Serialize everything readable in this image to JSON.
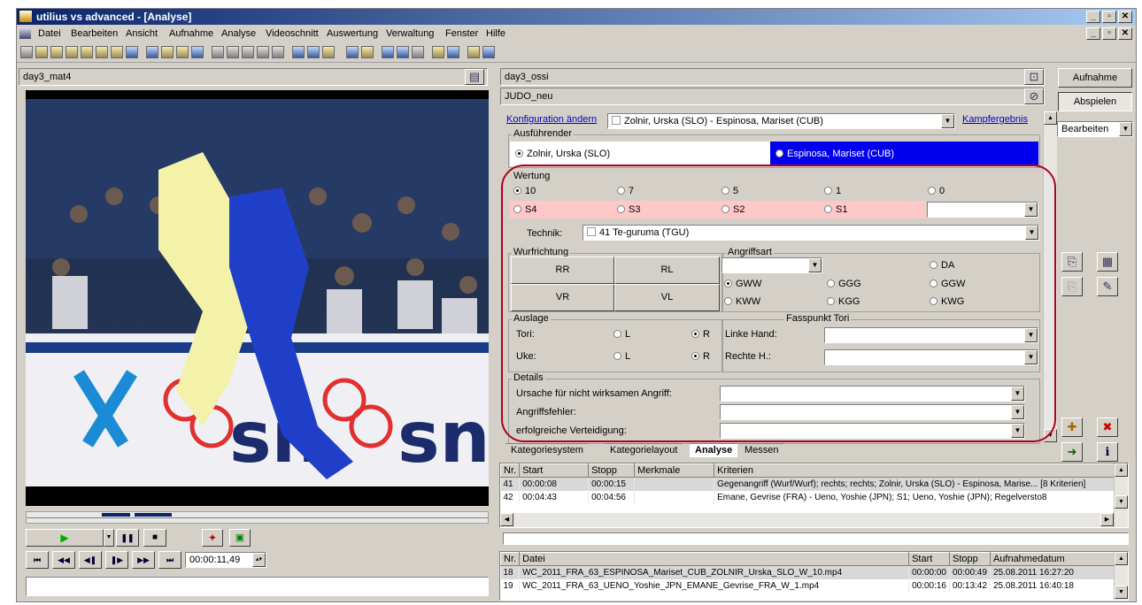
{
  "window": {
    "title": "utilius vs advanced - [Analyse]"
  },
  "menu": [
    "Datei",
    "Bearbeiten",
    "Ansicht",
    "Aufnahme",
    "Analyse",
    "Videoschnitt",
    "Auswertung",
    "Verwaltung",
    "Fenster",
    "Hilfe"
  ],
  "video_panel": {
    "title": "day3_mat4",
    "time": "00:00:11,49"
  },
  "right": {
    "field1": "day3_ossi",
    "field2": "JUDO_neu",
    "aufnahme_btn": "Aufnahme",
    "abspielen_btn": "Abspielen",
    "mode": "Bearbeiten"
  },
  "analyse": {
    "konfig_link": "Konfiguration ändern",
    "match": "Zolnir, Urska (SLO) - Espinosa, Mariset (CUB)",
    "kampf_link": "Kampfergebnis",
    "ausfuehrender_label": "Ausführender",
    "athlete1": "Zolnir, Urska (SLO)",
    "athlete2": "Espinosa, Mariset (CUB)",
    "wertung_label": "Wertung",
    "wertung": [
      "10",
      "7",
      "5",
      "1",
      "0"
    ],
    "strafen": [
      "S4",
      "S3",
      "S2",
      "S1"
    ],
    "technik_label": "Technik:",
    "technik": "41 Te-guruma (TGU)",
    "wurfrichtung_label": "Wurfrichtung",
    "wurf": [
      "RR",
      "RL",
      "VR",
      "VL"
    ],
    "angriffsart_label": "Angriffsart",
    "angriff": [
      "DA",
      "GWW",
      "GGG",
      "GGW",
      "KWW",
      "KGG",
      "KWG"
    ],
    "auslage_label": "Auslage",
    "tori_label": "Tori:",
    "uke_label": "Uke:",
    "L": "L",
    "R": "R",
    "fass_label": "Fasspunkt Tori",
    "linke_label": "Linke Hand:",
    "rechte_label": "Rechte H.:",
    "details_label": "Details",
    "ursache_label": "Ursache für nicht wirksamen Angriff:",
    "fehler_label": "Angriffsfehler:",
    "vert_label": "erfolgreiche Verteidigung:"
  },
  "tabs": [
    "Kategoriesystem",
    "Kategorielayout",
    "Analyse",
    "Messen"
  ],
  "events": {
    "headers": [
      "Nr.",
      "Start",
      "Stopp",
      "Merkmale",
      "Kriterien"
    ],
    "rows": [
      [
        "41",
        "00:00:08",
        "00:00:15",
        "",
        "Gegenangriff (Wurf/Wurf); rechts; rechts; Zolnir, Urska (SLO) - Espinosa, Marise... [8 Kriterien]"
      ],
      [
        "42",
        "00:04:43",
        "00:04:56",
        "",
        "Emane, Gevrise (FRA) - Ueno, Yoshie (JPN); S1; Ueno, Yoshie (JPN); Regelversto8"
      ]
    ]
  },
  "files": {
    "headers": [
      "Nr.",
      "Datei",
      "Start",
      "Stopp",
      "Aufnahmedatum"
    ],
    "rows": [
      [
        "18",
        "WC_2011_FRA_63_ESPINOSA_Mariset_CUB_ZOLNIR_Urska_SLO_W_10.mp4",
        "00:00:00",
        "00:00:49",
        "25.08.2011 16:27:20"
      ],
      [
        "19",
        "WC_2011_FRA_63_UENO_Yoshie_JPN_EMANE_Gevrise_FRA_W_1.mp4",
        "00:00:16",
        "00:13:42",
        "25.08.2011 16:40:18"
      ]
    ]
  },
  "colors": {
    "titlebar": "#0a246a",
    "selected_athlete": "#0000ee",
    "strafe_bg": "#ffc8c8",
    "highlight": "#b00020"
  }
}
